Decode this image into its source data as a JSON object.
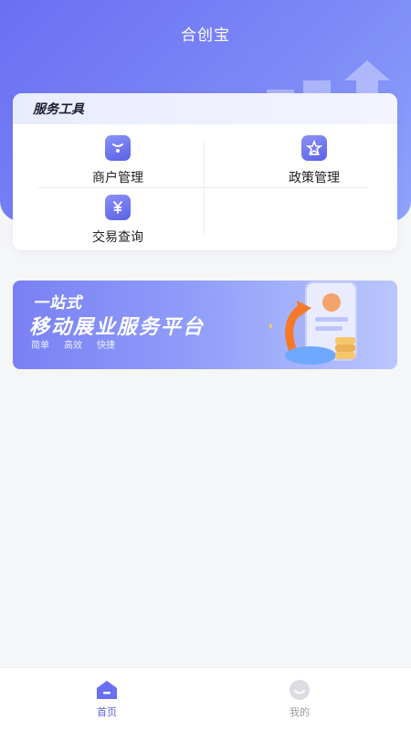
{
  "header": {
    "title": "合创宝"
  },
  "tools": {
    "heading": "服务工具",
    "items": [
      {
        "label": "商户管理",
        "icon": "merchant-bag-icon"
      },
      {
        "label": "政策管理",
        "icon": "policy-star-icon"
      },
      {
        "label": "交易查询",
        "icon": "transaction-yen-icon"
      }
    ]
  },
  "banner": {
    "line1": "一站式",
    "line2": "移动展业服务平台",
    "tags": [
      "简单",
      "高效",
      "快捷"
    ]
  },
  "tabbar": {
    "items": [
      {
        "label": "首页",
        "icon": "home-icon",
        "active": true
      },
      {
        "label": "我的",
        "icon": "profile-smile-icon",
        "active": false
      }
    ]
  },
  "colors": {
    "primary": "#5a61e6",
    "hero": "#6a6ff2",
    "background": "#f5f6f8"
  }
}
